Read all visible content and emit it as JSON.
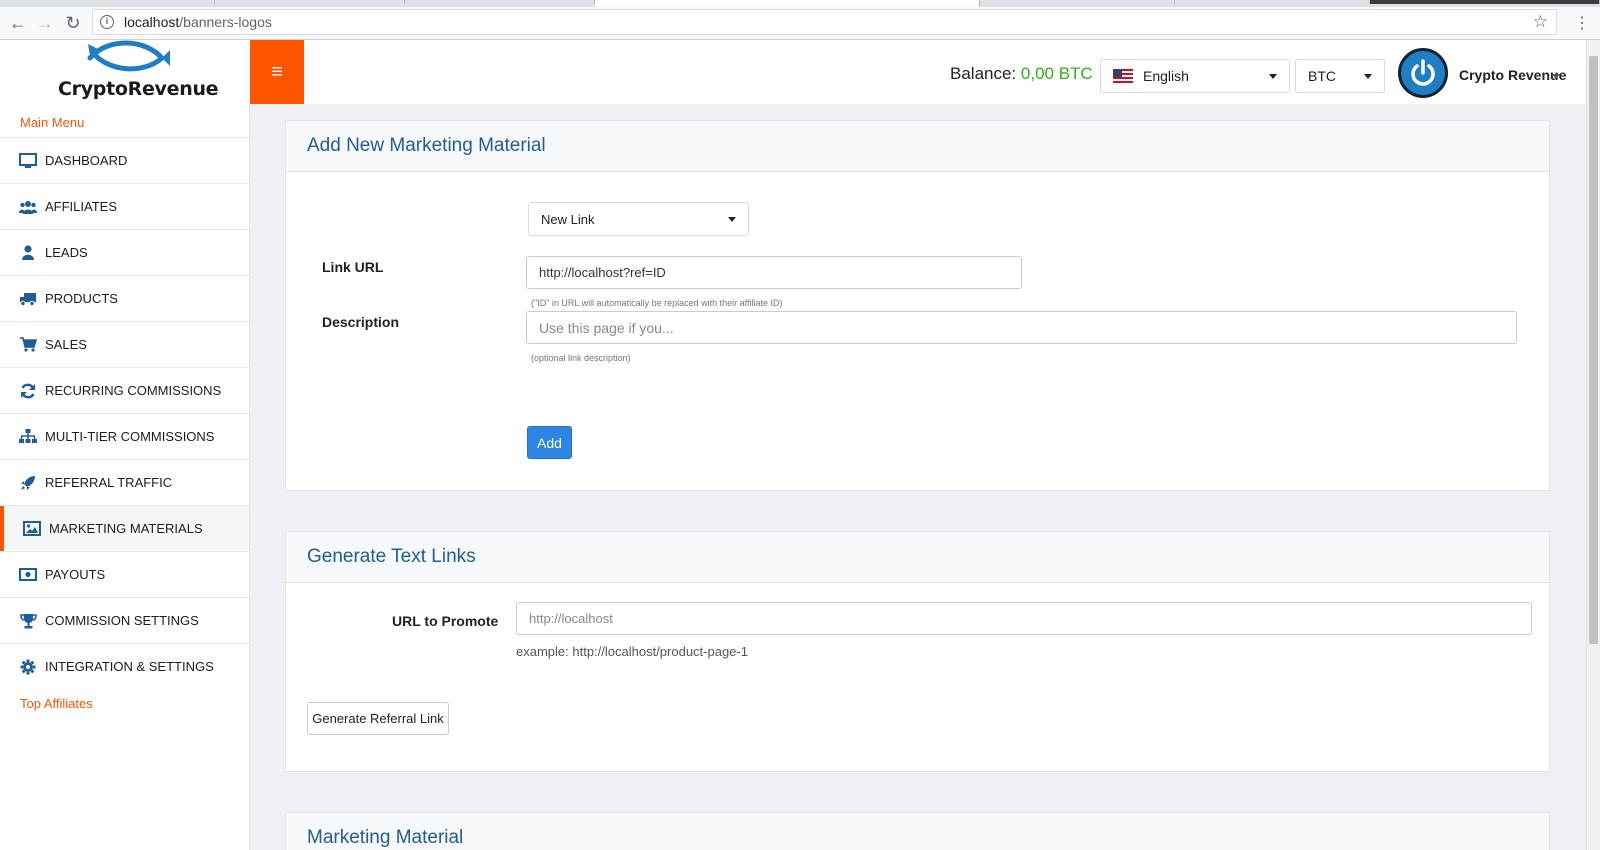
{
  "browser": {
    "url_host": "localhost",
    "url_path": "/banners-logos"
  },
  "header": {
    "logo_text": "CryptoRevenue",
    "balance_label": "Balance: ",
    "balance_value": "0,00 BTC",
    "language": "English",
    "currency": "BTC",
    "user_name": "Crypto Revenue"
  },
  "sidebar": {
    "heading": "Main Menu",
    "items": [
      {
        "label": "DASHBOARD",
        "icon": "monitor-icon"
      },
      {
        "label": "AFFILIATES",
        "icon": "users-icon"
      },
      {
        "label": "LEADS",
        "icon": "user-icon"
      },
      {
        "label": "PRODUCTS",
        "icon": "truck-icon"
      },
      {
        "label": "SALES",
        "icon": "cart-icon"
      },
      {
        "label": "RECURRING COMMISSIONS",
        "icon": "refresh-icon"
      },
      {
        "label": "MULTI-TIER COMMISSIONS",
        "icon": "sitemap-icon"
      },
      {
        "label": "REFERRAL TRAFFIC",
        "icon": "rocket-icon"
      },
      {
        "label": "MARKETING MATERIALS",
        "icon": "image-icon"
      },
      {
        "label": "PAYOUTS",
        "icon": "money-icon"
      },
      {
        "label": "COMMISSION SETTINGS",
        "icon": "trophy-icon"
      },
      {
        "label": "INTEGRATION & SETTINGS",
        "icon": "gear-icon"
      }
    ],
    "footer_heading": "Top Affiliates"
  },
  "add_material": {
    "title": "Add New Marketing Material",
    "type_selected": "New Link",
    "link_url_label": "Link URL",
    "link_url_value": "http://localhost?ref=ID",
    "link_url_hint": "(\"ID\" in URL will automatically be replaced with their affiliate ID)",
    "description_label": "Description",
    "description_placeholder": "Use this page if you...",
    "description_hint": "(optional link description)",
    "add_button": "Add"
  },
  "generate_links": {
    "title": "Generate Text Links",
    "url_label": "URL to Promote",
    "url_placeholder": "http://localhost",
    "example": "example: http://localhost/product-page-1",
    "generate_button": "Generate Referral Link"
  },
  "marketing_material": {
    "title": "Marketing Material"
  },
  "colors": {
    "accent": "#ff5500",
    "title_blue": "#1f5d99",
    "balance_green": "#2fb21b",
    "primary_button": "#2e86e4"
  }
}
